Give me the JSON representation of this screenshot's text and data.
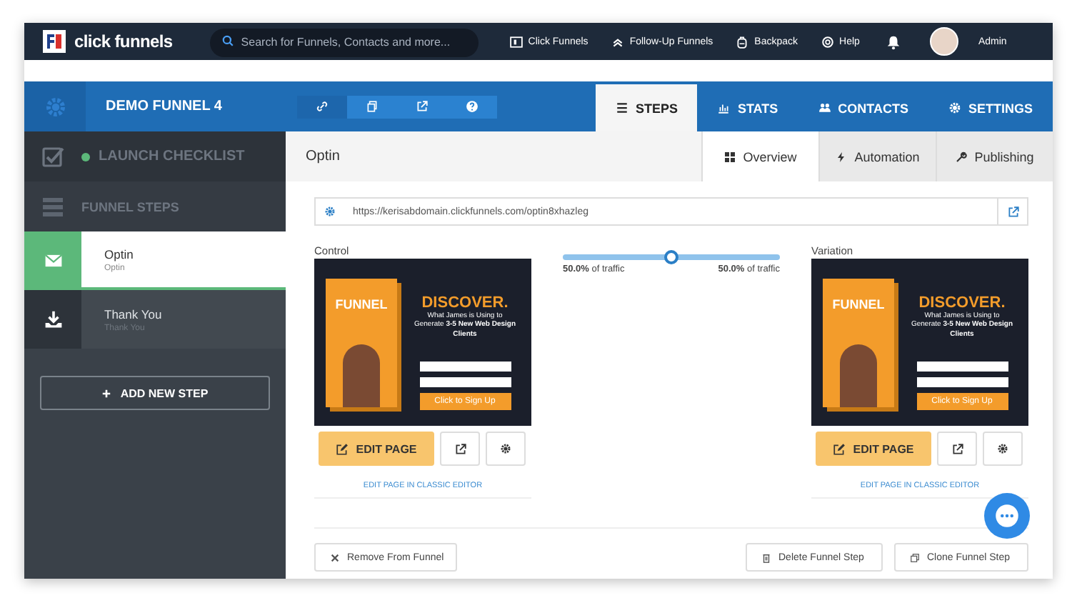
{
  "top_nav": {
    "logo": "click funnels",
    "search": {
      "placeholder": "Search for Funnels, Contacts and more..."
    },
    "links": [
      {
        "label": "Click Funnels"
      },
      {
        "label": "Follow-Up Funnels"
      },
      {
        "label": "Backpack"
      },
      {
        "label": "Help"
      }
    ],
    "user": "Admin"
  },
  "header": {
    "funnel_title": "DEMO FUNNEL 4",
    "tabs": [
      {
        "label": "STEPS",
        "selected": true
      },
      {
        "label": "STATS",
        "selected": false
      },
      {
        "label": "CONTACTS",
        "selected": false
      },
      {
        "label": "SETTINGS",
        "selected": false
      }
    ]
  },
  "sidebar": {
    "checklist": {
      "label": "LAUNCH CHECKLIST"
    },
    "section_title": "FUNNEL STEPS",
    "steps": [
      {
        "kind": "optin",
        "name": "Optin",
        "subtitle": "Optin",
        "selected": true
      },
      {
        "kind": "thankyou",
        "name": "Thank You",
        "subtitle": "Thank You",
        "selected": false
      }
    ],
    "add_button": "ADD NEW STEP"
  },
  "step": {
    "title": "Optin",
    "tabs": [
      {
        "label": "Overview",
        "selected": true
      },
      {
        "label": "Automation",
        "selected": false
      },
      {
        "label": "Publishing",
        "selected": false
      }
    ],
    "url": "https://kerisabdomain.clickfunnels.com/optin8xhazleg",
    "variants": [
      {
        "label": "Control",
        "preview": {
          "book": "FUNNEL",
          "headline": "DISCOVER.",
          "text": "What James is Using to Generate **3-5 New Web Design Clients**",
          "cta": "Click to Sign Up"
        },
        "edit_button": "EDIT PAGE",
        "classic_link": "EDIT PAGE IN CLASSIC EDITOR"
      },
      {
        "label": "Variation",
        "preview": {
          "book": "FUNNEL",
          "headline": "DISCOVER.",
          "text": "What James is Using to Generate **3-5 New Web Design Clients**",
          "cta": "Click to Sign Up"
        },
        "edit_button": "EDIT PAGE",
        "classic_link": "EDIT PAGE IN CLASSIC EDITOR"
      }
    ],
    "traffic": {
      "level": 0.5,
      "left": "**50.0%** of traffic",
      "right": "**50.0%** of traffic"
    },
    "actions": [
      {
        "kind": "remove",
        "label": "Remove From Funnel"
      },
      {
        "kind": "delete",
        "label": "Delete Funnel Step"
      },
      {
        "kind": "clone",
        "label": "Clone Funnel Step"
      }
    ]
  }
}
